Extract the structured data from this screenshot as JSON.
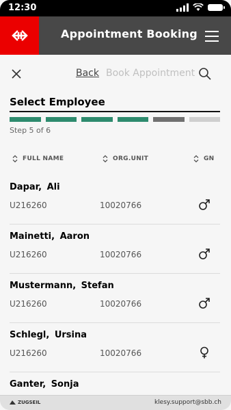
{
  "status": {
    "time": "12:30"
  },
  "appbar": {
    "title": "Appointment Booking"
  },
  "toolbar": {
    "back_label": "Back",
    "current_label": "Book Appointment"
  },
  "section": {
    "title": "Select Employee",
    "step_text": "Step 5 of 6"
  },
  "progress": {
    "steps": [
      "#2e8b6e",
      "#2e8b6e",
      "#2e8b6e",
      "#2e8b6e",
      "#707070",
      "#cfcfcf"
    ]
  },
  "table": {
    "headers": {
      "name": "FULL NAME",
      "org": "ORG.UNIT",
      "gender": "GN"
    },
    "rows": [
      {
        "name": "Dapar,  Ali",
        "id": "U216260",
        "org": "10020766",
        "gender": "male-icon"
      },
      {
        "name": "Mainetti,  Aaron",
        "id": "U216260",
        "org": "10020766",
        "gender": "male-icon"
      },
      {
        "name": "Mustermann,  Stefan",
        "id": "U216260",
        "org": "10020766",
        "gender": "male-icon"
      },
      {
        "name": "Schlegl,  Ursina",
        "id": "U216260",
        "org": "10020766",
        "gender": "female-icon"
      },
      {
        "name": "Ganter,  Sonja"
      }
    ]
  },
  "footer": {
    "brand": "ZUGSEIL",
    "email": "klesy.support@sbb.ch"
  },
  "colors": {
    "brand_red": "#eb0000",
    "appbar": "#484848",
    "accent_green": "#2e8b6e"
  }
}
